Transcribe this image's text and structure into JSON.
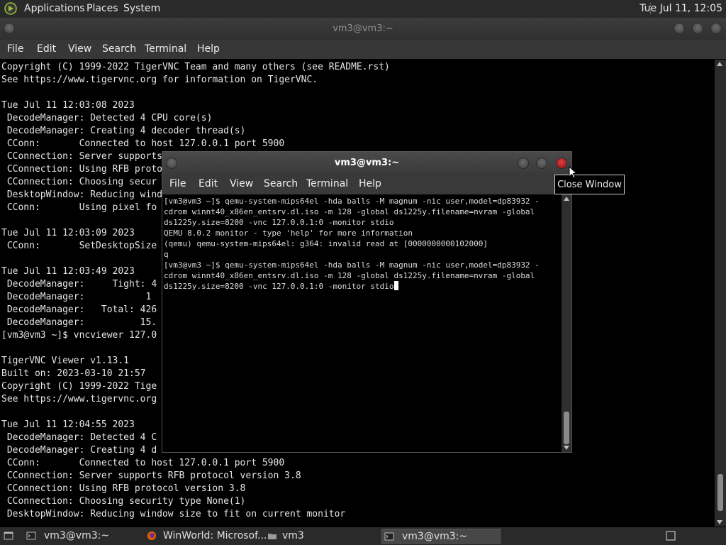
{
  "top_panel": {
    "menus": [
      "Applications",
      "Places",
      "System"
    ],
    "clock": "Tue Jul 11, 12:05"
  },
  "background_window": {
    "title": "vm3@vm3:~",
    "menu": [
      "File",
      "Edit",
      "View",
      "Search",
      "Terminal",
      "Help"
    ],
    "lines": [
      "Copyright (C) 1999-2022 TigerVNC Team and many others (see README.rst)",
      "See https://www.tigervnc.org for information on TigerVNC.",
      "",
      "Tue Jul 11 12:03:08 2023",
      " DecodeManager: Detected 4 CPU core(s)",
      " DecodeManager: Creating 4 decoder thread(s)",
      " CConn:       Connected to host 127.0.0.1 port 5900",
      " CConnection: Server supports",
      " CConnection: Using RFB proto",
      " CConnection: Choosing secur",
      " DesktopWindow: Reducing wind",
      " CConn:       Using pixel fo",
      "",
      "Tue Jul 11 12:03:09 2023",
      " CConn:       SetDesktopSize",
      "",
      "Tue Jul 11 12:03:49 2023",
      " DecodeManager:     Tight: 4",
      " DecodeManager:           1",
      " DecodeManager:   Total: 426",
      " DecodeManager:          15.",
      "[vm3@vm3 ~]$ vncviewer 127.0",
      "",
      "TigerVNC Viewer v1.13.1",
      "Built on: 2023-03-10 21:57",
      "Copyright (C) 1999-2022 Tige",
      "See https://www.tigervnc.org",
      "",
      "Tue Jul 11 12:04:55 2023",
      " DecodeManager: Detected 4 C",
      " DecodeManager: Creating 4 d",
      " CConn:       Connected to host 127.0.0.1 port 5900",
      " CConnection: Server supports RFB protocol version 3.8",
      " CConnection: Using RFB protocol version 3.8",
      " CConnection: Choosing security type None(1)",
      " DesktopWindow: Reducing window size to fit on current monitor"
    ]
  },
  "front_window": {
    "title": "vm3@vm3:~",
    "menu": [
      "File",
      "Edit",
      "View",
      "Search",
      "Terminal",
      "Help"
    ],
    "lines": [
      "[vm3@vm3 ~]$ qemu-system-mips64el -hda balls -M magnum -nic user,model=dp83932 -",
      "cdrom winnt40_x86en_entsrv.dl.iso -m 128 -global ds1225y.filename=nvram -global",
      "ds1225y.size=8200 -vnc 127.0.0.1:0 -monitor stdio",
      "QEMU 8.0.2 monitor - type 'help' for more information",
      "(qemu) qemu-system-mips64el: g364: invalid read at [0000000000102000]",
      "q",
      "[vm3@vm3 ~]$ qemu-system-mips64el -hda balls -M magnum -nic user,model=dp83932 -",
      "cdrom winnt40_x86en_entsrv.dl.iso -m 128 -global ds1225y.filename=nvram -global",
      "ds1225y.size=8200 -vnc 127.0.0.1:0 -monitor stdio"
    ]
  },
  "tooltip": "Close Window",
  "taskbar": {
    "tasks": [
      "vm3@vm3:~",
      "WinWorld: Microsof...",
      "vm3",
      "vm3@vm3:~"
    ]
  }
}
